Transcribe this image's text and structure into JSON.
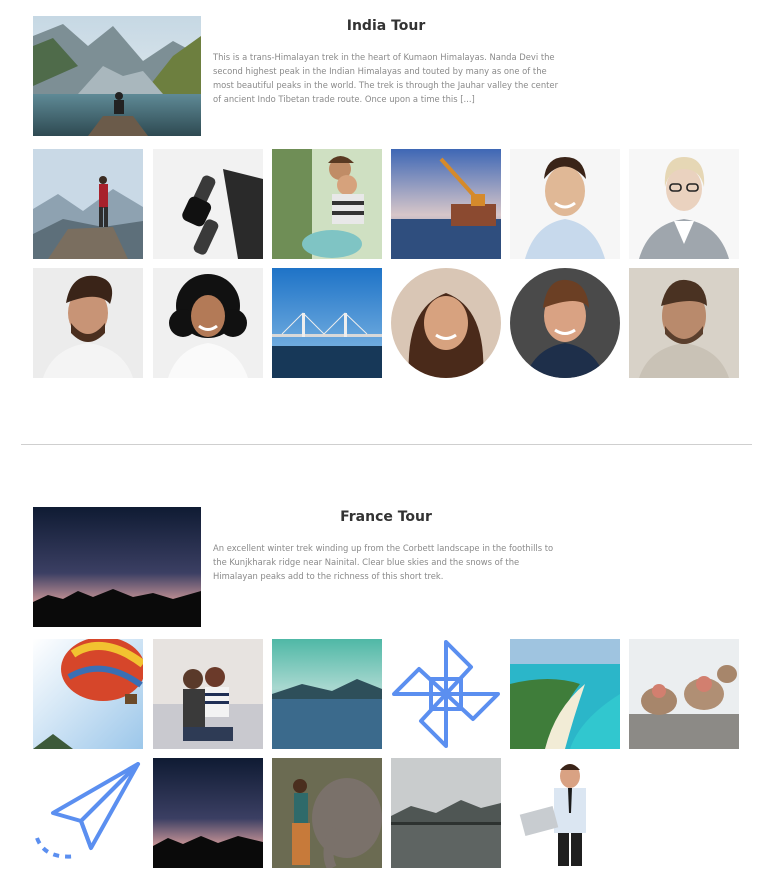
{
  "india": {
    "title": "India Tour",
    "description": "This is a trans-Himalayan trek in the heart of Kumaon Himalayas. Nanda Devi the second highest peak in the Indian Himalayas and touted by many as one of the most beautiful peaks in the world. The trek is through the Jauhar valley the center of ancient Indo Tibetan trade route. Once upon a time this [...]",
    "hero_image": "mountain-lake-image",
    "gallery": [
      "hiker-on-rock-image",
      "smartwatch-laptop-image",
      "couple-on-scooter-image",
      "harbor-crane-image",
      "smiling-man-portrait-image",
      "woman-with-glasses-portrait-image",
      "man-side-profile-image",
      "curly-hair-woman-image",
      "cable-bridge-image",
      "smiling-woman-round-image",
      "smiling-man-round-image",
      "bearded-man-portrait-image"
    ]
  },
  "france": {
    "title": "France Tour",
    "description": "An excellent winter trek winding up from the Corbett landscape in the foothills to the Kunjkharak ridge near Nainital. Clear blue skies and the snows of the Himalayan peaks add to the richness of this short trek.",
    "hero_image": "dusk-mountain-silhouette-image",
    "gallery": [
      "hot-air-balloon-image",
      "couple-by-water-image",
      "calm-lake-image",
      "pinwheel-icon",
      "tropical-beach-image",
      "snow-monkeys-image",
      "paper-plane-icon",
      "dusk-silhouette-image",
      "woman-with-elephant-image",
      "misty-lake-image",
      "businessman-with-laptop-image"
    ]
  },
  "colors": {
    "title": "#333333",
    "body_text": "#8a8a8a",
    "divider": "#cfcfcf",
    "icon_blue": "#5b8ff0"
  }
}
